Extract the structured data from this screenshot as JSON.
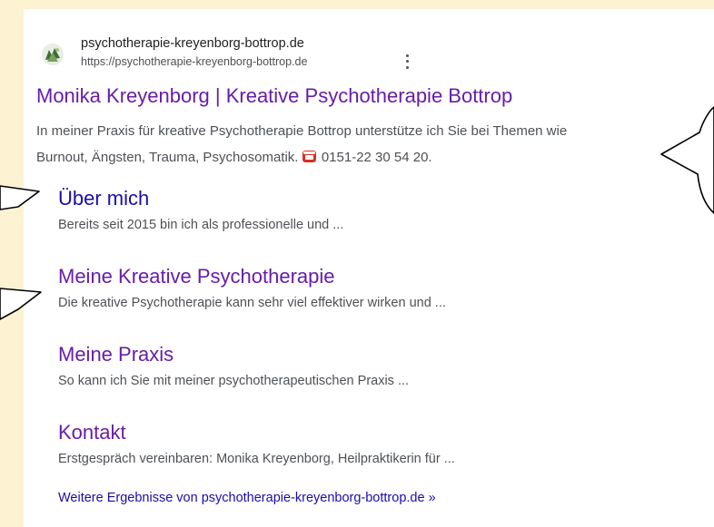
{
  "result": {
    "site_name": "psychotherapie-kreyenborg-bottrop.de",
    "url": "https://psychotherapie-kreyenborg-bottrop.de",
    "title": "Monika Kreyenborg | Kreative Psychotherapie Bottrop",
    "snippet_line1": "In meiner Praxis für kreative Psychotherapie Bottrop unterstütze ich Sie bei Themen wie",
    "snippet_line2_text": "Burnout, Ängsten, Trauma, Psychosomatik.",
    "snippet_phone": "0151-22 30 54 20.",
    "favicon_icon": "site-favicon-icon",
    "phone_icon": "telephone-icon",
    "menu_icon": "three-dots-vertical-icon"
  },
  "sitelinks": [
    {
      "title": "Über mich",
      "description": "Bereits seit 2015 bin ich als professionelle und ..."
    },
    {
      "title": "Meine Kreative Psychotherapie",
      "description": "Die kreative Psychotherapie kann sehr viel effektiver wirken und ..."
    },
    {
      "title": "Meine Praxis",
      "description": "So kann ich Sie mit meiner psychotherapeutischen Praxis ..."
    },
    {
      "title": "Kontakt",
      "description": "Erstgespräch vereinbaren: Monika Kreyenborg, Heilpraktikerin für ..."
    }
  ],
  "more_results": "Weitere Ergebnisse von psychotherapie-kreyenborg-bottrop.de »",
  "colors": {
    "background": "#fdf3d2",
    "visited_link": "#681da8",
    "link": "#1a0dab",
    "text": "#4d5156"
  }
}
